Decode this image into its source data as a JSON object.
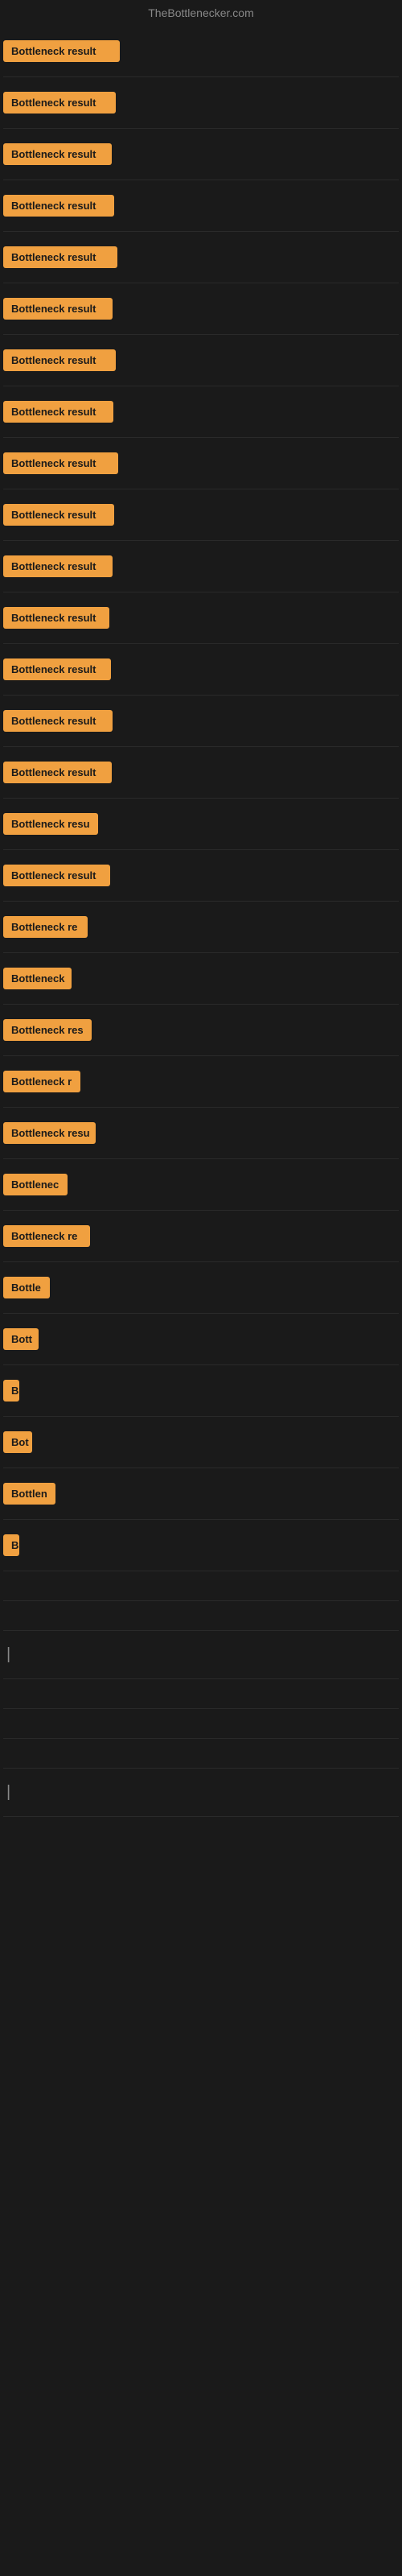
{
  "header": {
    "title": "TheBottlenecker.com"
  },
  "items": [
    {
      "label": "Bottleneck result",
      "width": 145
    },
    {
      "label": "Bottleneck result",
      "width": 140
    },
    {
      "label": "Bottleneck result",
      "width": 135
    },
    {
      "label": "Bottleneck result",
      "width": 138
    },
    {
      "label": "Bottleneck result",
      "width": 142
    },
    {
      "label": "Bottleneck result",
      "width": 136
    },
    {
      "label": "Bottleneck result",
      "width": 140
    },
    {
      "label": "Bottleneck result",
      "width": 137
    },
    {
      "label": "Bottleneck result",
      "width": 143
    },
    {
      "label": "Bottleneck result",
      "width": 138
    },
    {
      "label": "Bottleneck result",
      "width": 136
    },
    {
      "label": "Bottleneck result",
      "width": 132
    },
    {
      "label": "Bottleneck result",
      "width": 134
    },
    {
      "label": "Bottleneck result",
      "width": 136
    },
    {
      "label": "Bottleneck result",
      "width": 135
    },
    {
      "label": "Bottleneck resu",
      "width": 118
    },
    {
      "label": "Bottleneck result",
      "width": 133
    },
    {
      "label": "Bottleneck re",
      "width": 105
    },
    {
      "label": "Bottleneck",
      "width": 85
    },
    {
      "label": "Bottleneck res",
      "width": 110
    },
    {
      "label": "Bottleneck r",
      "width": 96
    },
    {
      "label": "Bottleneck resu",
      "width": 115
    },
    {
      "label": "Bottlenec",
      "width": 80
    },
    {
      "label": "Bottleneck re",
      "width": 108
    },
    {
      "label": "Bottle",
      "width": 58
    },
    {
      "label": "Bott",
      "width": 44
    },
    {
      "label": "B",
      "width": 18
    },
    {
      "label": "Bot",
      "width": 36
    },
    {
      "label": "Bottlen",
      "width": 65
    },
    {
      "label": "B",
      "width": 16
    },
    {
      "label": "",
      "width": 0
    },
    {
      "label": "",
      "width": 0
    },
    {
      "label": "|",
      "width": 8
    },
    {
      "label": "",
      "width": 0
    },
    {
      "label": "",
      "width": 0
    },
    {
      "label": "",
      "width": 0
    },
    {
      "label": "|",
      "width": 8
    }
  ]
}
